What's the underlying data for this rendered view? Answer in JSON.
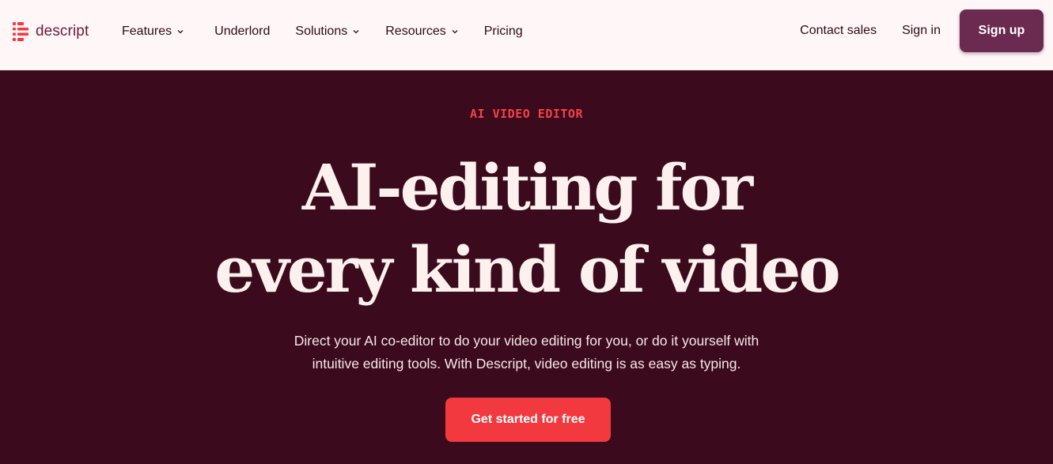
{
  "brand": {
    "name": "descript",
    "logo_icon": "descript-logo-icon",
    "accent_color": "#f2393f"
  },
  "nav": {
    "items": [
      {
        "label": "Features",
        "has_dropdown": true
      },
      {
        "label": "Underlord",
        "has_dropdown": false
      },
      {
        "label": "Solutions",
        "has_dropdown": true
      },
      {
        "label": "Resources",
        "has_dropdown": true
      },
      {
        "label": "Pricing",
        "has_dropdown": false
      }
    ],
    "contact_sales": "Contact sales",
    "sign_in": "Sign in",
    "sign_up": "Sign up"
  },
  "hero": {
    "eyebrow": "AI VIDEO EDITOR",
    "headline_line1": "AI-editing for",
    "headline_line2": "every kind of video",
    "subtext_line1": "Direct your AI co-editor to do your video editing for you, or do it yourself with",
    "subtext_line2": "intuitive editing tools. With Descript, video editing is as easy as typing.",
    "cta": "Get started for free"
  },
  "colors": {
    "nav_background": "#fff6f8",
    "hero_background": "#3b0a1c",
    "sign_up_button": "#6b2a4f",
    "eyebrow_text": "#f2424a",
    "headline_text": "#fdf1ef"
  }
}
